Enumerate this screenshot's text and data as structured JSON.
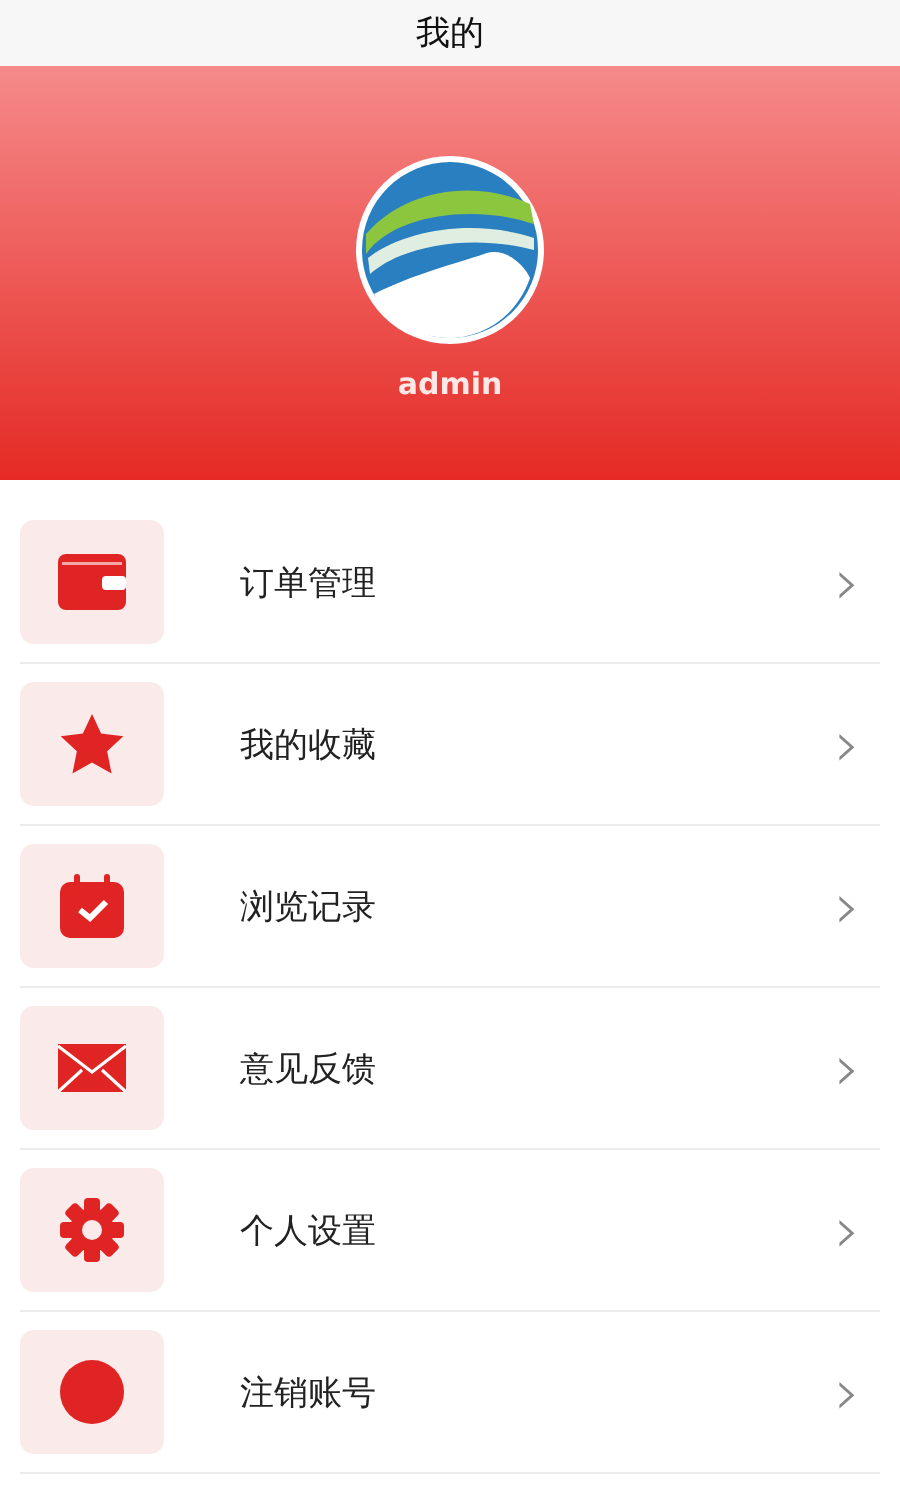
{
  "title": "我的",
  "profile": {
    "username": "admin"
  },
  "menu": [
    {
      "kind": "wallet",
      "label": "订单管理",
      "chevron": "›"
    },
    {
      "kind": "star",
      "label": "我的收藏",
      "chevron": "›"
    },
    {
      "kind": "calendar",
      "label": "浏览记录",
      "chevron": "›"
    },
    {
      "kind": "mail",
      "label": "意见反馈",
      "chevron": "›"
    },
    {
      "kind": "gear",
      "label": "个人设置",
      "chevron": "›"
    },
    {
      "kind": "dot",
      "label": "注销账号",
      "chevron": "›"
    }
  ]
}
